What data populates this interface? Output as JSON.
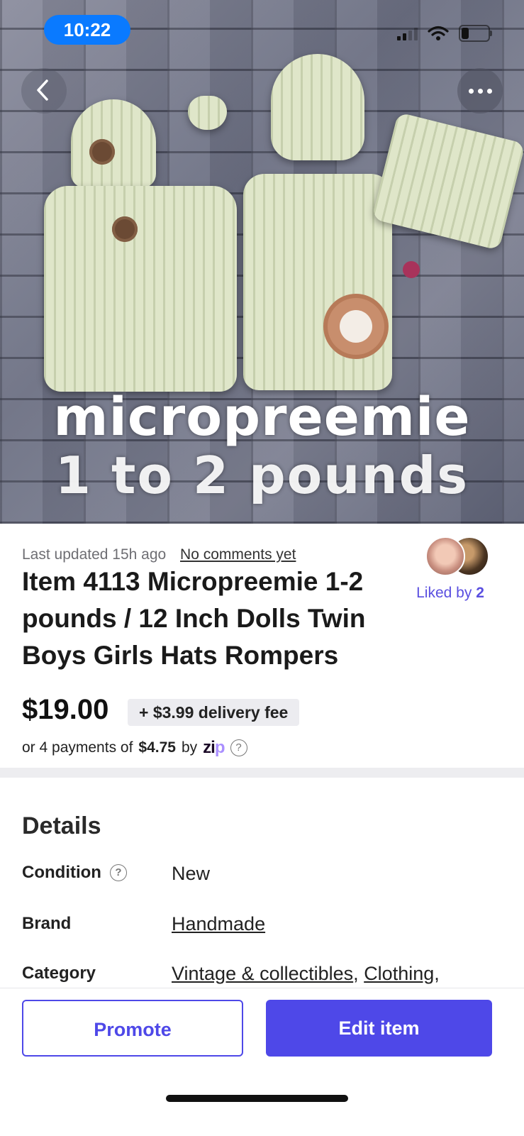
{
  "status_bar": {
    "time": "10:22"
  },
  "hero": {
    "overlay_line1": "micropreemie",
    "overlay_line2": "1 to 2 pounds"
  },
  "listing": {
    "last_updated": "Last updated 15h ago",
    "comments_link": "No comments yet",
    "title": "Item 4113 Micropreemie 1-2 pounds / 12 Inch Dolls Twin Boys Girls Hats Rompers",
    "liked_by_prefix": "Liked by",
    "liked_by_count": "2",
    "price": "$19.00",
    "delivery_fee": "+ $3.99 delivery fee",
    "payments_prefix": "or 4 payments of",
    "payments_amount": "$4.75",
    "payments_by": "by",
    "zip_logo_a": "zi",
    "zip_logo_b": "p",
    "help_glyph": "?"
  },
  "details": {
    "heading": "Details",
    "condition_label": "Condition",
    "condition_value": "New",
    "brand_label": "Brand",
    "brand_value": "Handmade",
    "category_label": "Category",
    "category_value_1": "Vintage & collectibles",
    "category_sep": ", ",
    "category_value_2": "Clothing",
    "category_trail": ","
  },
  "actions": {
    "promote_label": "Promote",
    "edit_label": "Edit item"
  },
  "colors": {
    "accent": "#4e48e8",
    "status_pill": "#0a7aff"
  }
}
